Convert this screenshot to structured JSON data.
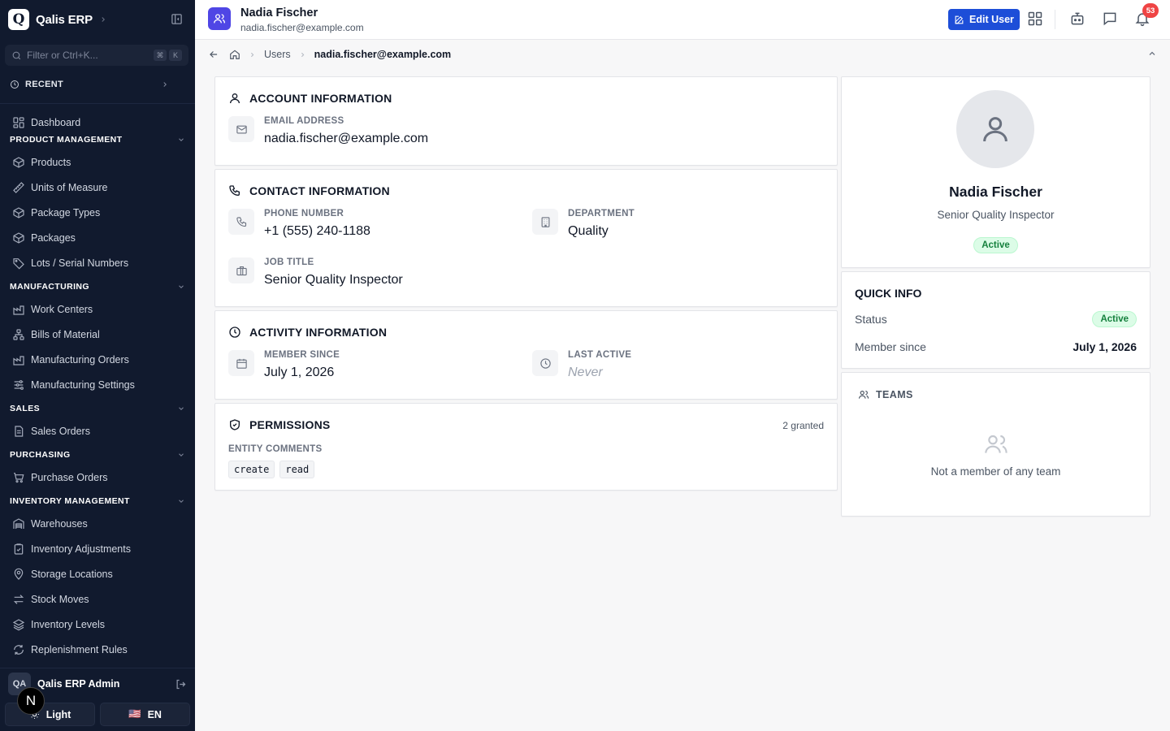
{
  "app": {
    "name": "Qalis ERP",
    "logo_letter": "Q"
  },
  "sidebar": {
    "filter_placeholder": "Filter or Ctrl+K...",
    "kbd1": "⌘",
    "kbd2": "K",
    "recent_label": "RECENT",
    "dashboard": "Dashboard",
    "sections": {
      "product": "PRODUCT MANAGEMENT",
      "manufacturing": "MANUFACTURING",
      "sales": "SALES",
      "purchasing": "PURCHASING",
      "inventory": "INVENTORY MANAGEMENT"
    },
    "items": {
      "products": "Products",
      "uom": "Units of Measure",
      "package_types": "Package Types",
      "packages": "Packages",
      "lots": "Lots / Serial Numbers",
      "work_centers": "Work Centers",
      "bom": "Bills of Material",
      "mo": "Manufacturing Orders",
      "mfg_settings": "Manufacturing Settings",
      "sales_orders": "Sales Orders",
      "purchase_orders": "Purchase Orders",
      "warehouses": "Warehouses",
      "inv_adj": "Inventory Adjustments",
      "storage": "Storage Locations",
      "stock_moves": "Stock Moves",
      "inv_levels": "Inventory Levels",
      "replenish": "Replenishment Rules"
    },
    "footer": {
      "user_initials": "QA",
      "user_name": "Qalis ERP Admin",
      "n_badge": "N",
      "theme": "Light",
      "lang": "EN",
      "flag": "🇺🇸"
    }
  },
  "header": {
    "name": "Nadia Fischer",
    "email": "nadia.fischer@example.com",
    "edit_button": "Edit User",
    "notification_count": "53"
  },
  "breadcrumb": {
    "users": "Users",
    "current": "nadia.fischer@example.com"
  },
  "account": {
    "title": "ACCOUNT INFORMATION",
    "email_label": "EMAIL ADDRESS",
    "email_value": "nadia.fischer@example.com"
  },
  "contact": {
    "title": "CONTACT INFORMATION",
    "phone_label": "PHONE NUMBER",
    "phone_value": "+1 (555) 240-1188",
    "dept_label": "DEPARTMENT",
    "dept_value": "Quality",
    "job_label": "JOB TITLE",
    "job_value": "Senior Quality Inspector"
  },
  "activity": {
    "title": "ACTIVITY INFORMATION",
    "member_label": "MEMBER SINCE",
    "member_value": "July 1, 2026",
    "last_label": "LAST ACTIVE",
    "last_value": "Never"
  },
  "permissions": {
    "title": "PERMISSIONS",
    "count": "2 granted",
    "group": "ENTITY COMMENTS",
    "chips": [
      "create",
      "read"
    ]
  },
  "profile": {
    "name": "Nadia Fischer",
    "title": "Senior Quality Inspector",
    "status": "Active"
  },
  "quick_info": {
    "title": "QUICK INFO",
    "status_label": "Status",
    "status_value": "Active",
    "member_label": "Member since",
    "member_value": "July 1, 2026"
  },
  "teams": {
    "title": "TEAMS",
    "empty": "Not a member of any team"
  },
  "colors": {
    "sidebar_bg": "#111a2e",
    "accent": "#1d4ed8",
    "active_green": "#15803d",
    "badge_red": "#ef4444"
  }
}
